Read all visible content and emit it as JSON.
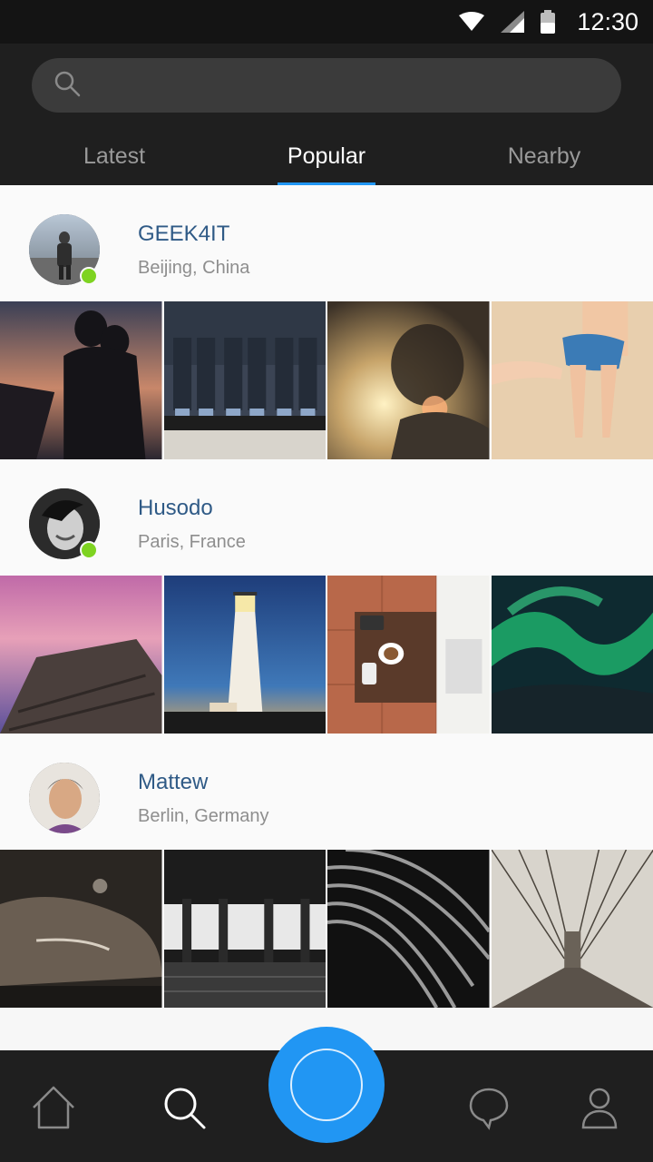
{
  "status": {
    "time": "12:30",
    "icons": [
      "wifi-icon",
      "signal-icon",
      "battery-icon"
    ]
  },
  "search": {
    "placeholder": "",
    "icon": "search-icon"
  },
  "tabs": [
    {
      "label": "Latest",
      "active": false
    },
    {
      "label": "Popular",
      "active": true
    },
    {
      "label": "Nearby",
      "active": false
    }
  ],
  "users": [
    {
      "name": "GEEK4IT",
      "location": "Beijing, China",
      "online": true,
      "photos": [
        "sunset-couple-photo",
        "suits-socks-photo",
        "sunlit-face-photo",
        "beach-hand-photo"
      ]
    },
    {
      "name": "Husodo",
      "location": "Paris, France",
      "online": true,
      "photos": [
        "pier-sunset-photo",
        "lighthouse-photo",
        "coffee-table-photo",
        "aurora-photo"
      ]
    },
    {
      "name": "Mattew",
      "location": "Berlin, Germany",
      "online": false,
      "photos": [
        "vintage-car-photo",
        "subway-station-photo",
        "architecture-curves-photo",
        "bridge-cables-photo"
      ]
    }
  ],
  "bottom_nav": [
    "home-icon",
    "search-icon",
    "camera-icon",
    "chat-icon",
    "profile-icon"
  ],
  "colors": {
    "accent": "#2196f3",
    "online": "#7ed321",
    "username": "#2f5a86",
    "header_bg": "#1f1f1f"
  }
}
